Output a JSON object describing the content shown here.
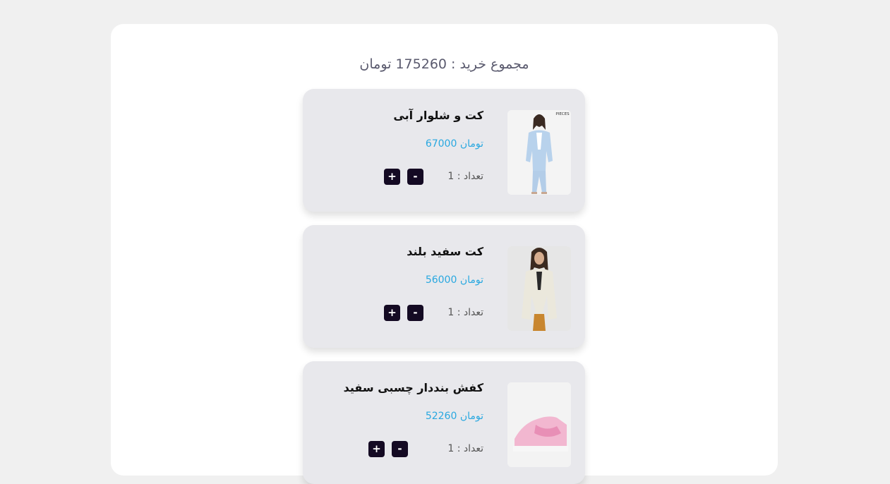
{
  "cart": {
    "total_label": "مجموع خرید : 175260 تومان"
  },
  "items": [
    {
      "title": "کت و شلوار آبی",
      "price": "تومان 67000",
      "quantity": "تعداد : 1",
      "minus": "-",
      "plus": "+",
      "brand_mark": "PIECES"
    },
    {
      "title": "کت سفید بلند",
      "price": "تومان 56000",
      "quantity": "تعداد : 1",
      "minus": "-",
      "plus": "+"
    },
    {
      "title": "کفش بنددار چسبی سفید",
      "price": "تومان 52260",
      "quantity": "تعداد : 1",
      "minus": "-",
      "plus": "+"
    }
  ],
  "colors": {
    "page_bg": "#f0f0f0",
    "card_bg": "#e8e8ec",
    "price": "#29a8e0",
    "button_bg": "#140a23"
  }
}
